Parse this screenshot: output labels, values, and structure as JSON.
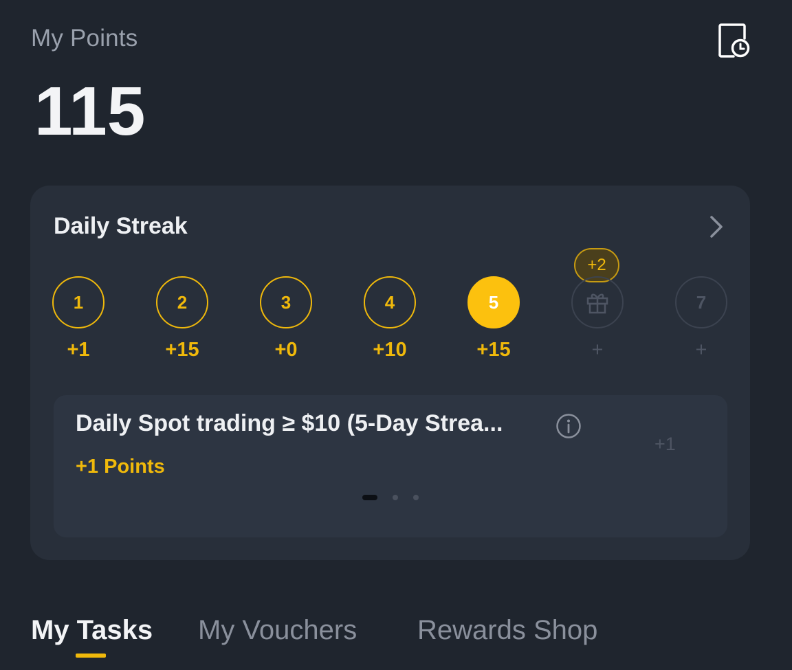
{
  "header": {
    "title": "My Points",
    "points": "115",
    "history_icon": "history-icon"
  },
  "streak": {
    "title": "Daily Streak",
    "bonus_badge": "+2",
    "days": [
      {
        "label": "1",
        "points": "+1",
        "state": "completed"
      },
      {
        "label": "2",
        "points": "+15",
        "state": "completed"
      },
      {
        "label": "3",
        "points": "+0",
        "state": "completed"
      },
      {
        "label": "4",
        "points": "+10",
        "state": "completed"
      },
      {
        "label": "5",
        "points": "+15",
        "state": "active"
      },
      {
        "label": "",
        "icon": "gift-icon",
        "points": "+",
        "state": "pending"
      },
      {
        "label": "7",
        "points": "+",
        "state": "pending"
      }
    ]
  },
  "task": {
    "title": "Daily Spot trading ≥ $10 (5-Day Strea...",
    "reward": "+1 Points",
    "side_value": "+1",
    "carousel_total": 3,
    "carousel_active": 1
  },
  "tabs": [
    {
      "label": "My Tasks",
      "active": true
    },
    {
      "label": "My Vouchers",
      "active": false
    },
    {
      "label": "Rewards Shop",
      "active": false
    }
  ],
  "colors": {
    "background": "#1f252e",
    "card": "#282f3a",
    "accent": "#f0b90b",
    "muted": "#4e5563"
  }
}
